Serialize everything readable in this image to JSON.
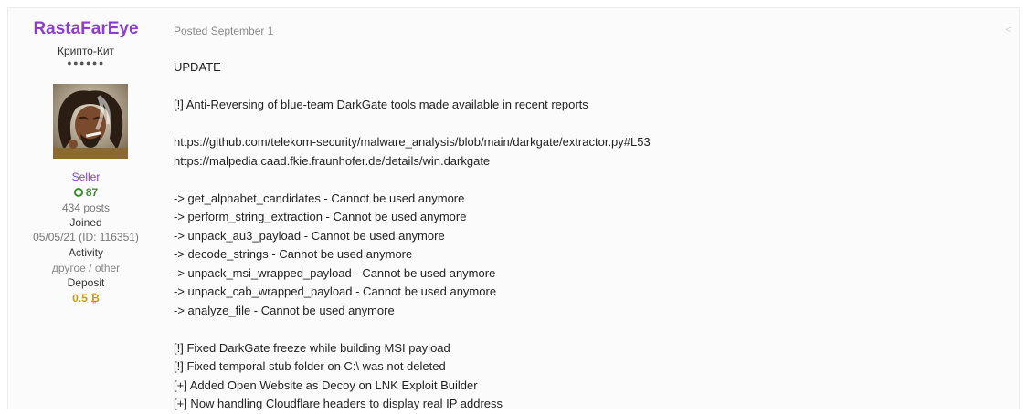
{
  "author": {
    "username": "RastaFarEye",
    "title": "Крипто-Кит",
    "rank_dots": "●●●●●●",
    "group": "Seller",
    "reputation": "87",
    "posts": "434 posts",
    "joined_label": "Joined",
    "joined_value": "05/05/21 (ID: 116351)",
    "activity_label": "Activity",
    "activity_value": "другое / other",
    "deposit_label": "Deposit",
    "deposit_value": "0.5 ₿"
  },
  "post": {
    "date": "Posted September 1",
    "heading": "UPDATE",
    "intro": "[!] Anti-Reversing of blue-team DarkGate tools made available in recent reports",
    "links": [
      "https://github.com/telekom-security/malware_analysis/blob/main/darkgate/extractor.py#L53",
      "https://malpedia.caad.fkie.fraunhofer.de/details/win.darkgate"
    ],
    "functions": [
      "-> get_alphabet_candidates - Cannot be used anymore",
      "-> perform_string_extraction - Cannot be used anymore",
      "-> unpack_au3_payload - Cannot be used anymore",
      "-> decode_strings - Cannot be used anymore",
      "-> unpack_msi_wrapped_payload - Cannot be used anymore",
      "-> unpack_cab_wrapped_payload - Cannot be used anymore",
      "-> analyze_file - Cannot be used anymore"
    ],
    "changes": [
      "[!] Fixed DarkGate freeze while building MSI payload",
      "[!] Fixed temporal stub folder on C:\\ was not deleted",
      "[+] Added Open Website as Decoy on LNK Exploit Builder",
      "[+] Now handling Cloudflare headers to display real IP address"
    ]
  },
  "colors": {
    "username": "#8b3ec9",
    "reputation": "#3d8a30",
    "deposit": "#c99a12"
  },
  "icons": {
    "reputation": "reputation-circle-icon",
    "share": "share-icon"
  }
}
